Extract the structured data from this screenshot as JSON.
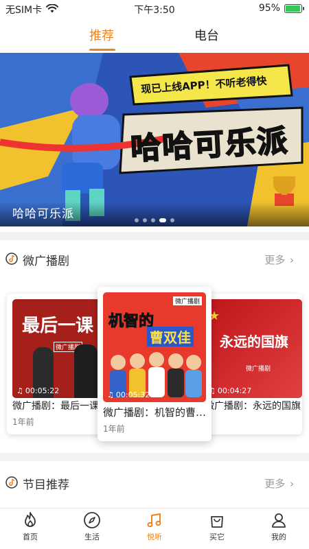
{
  "status_bar": {
    "carrier": "无SIM卡",
    "time": "下午3:50",
    "battery_percent": "95%",
    "battery_level": 0.95,
    "icons": [
      "wifi-icon",
      "battery-icon"
    ]
  },
  "tabs": [
    {
      "label": "推荐",
      "active": true
    },
    {
      "label": "电台",
      "active": false
    }
  ],
  "banner": {
    "headline": "现已上线APP！不听老得快",
    "title_art": "哈哈可乐派",
    "caption": "哈哈可乐派",
    "slide_count": 5,
    "active_slide": 3
  },
  "section_radio_drama": {
    "title": "微广播剧",
    "more": "更多",
    "items": [
      {
        "cover_text": "最后一课",
        "cover_tag": "微广播剧",
        "duration": "00:05:22",
        "title": "微广播剧：最后一课",
        "date": "1年前"
      },
      {
        "cover_text_1": "机智的",
        "cover_text_2": "曹双佳",
        "cover_tag": "微广播剧",
        "duration": "00:05:32",
        "title": "微广播剧：机智的曹双佳",
        "date": "1年前"
      },
      {
        "cover_text": "永远的国旗",
        "cover_tag": "微广播剧",
        "duration": "00:04:27",
        "title": "微广播剧：永远的国旗",
        "date": "1年前"
      }
    ]
  },
  "section_programs": {
    "title": "节目推荐",
    "more": "更多"
  },
  "bottom_nav": [
    {
      "label": "首页",
      "icon": "flame-icon",
      "active": false
    },
    {
      "label": "生活",
      "icon": "compass-icon",
      "active": false
    },
    {
      "label": "悦听",
      "icon": "music-note-icon",
      "active": true
    },
    {
      "label": "买它",
      "icon": "shopping-bag-icon",
      "active": false
    },
    {
      "label": "我的",
      "icon": "person-icon",
      "active": false
    }
  ],
  "colors": {
    "accent": "#f0821e",
    "separator": "#f2f2f2",
    "muted_text": "#9a9a9a"
  }
}
